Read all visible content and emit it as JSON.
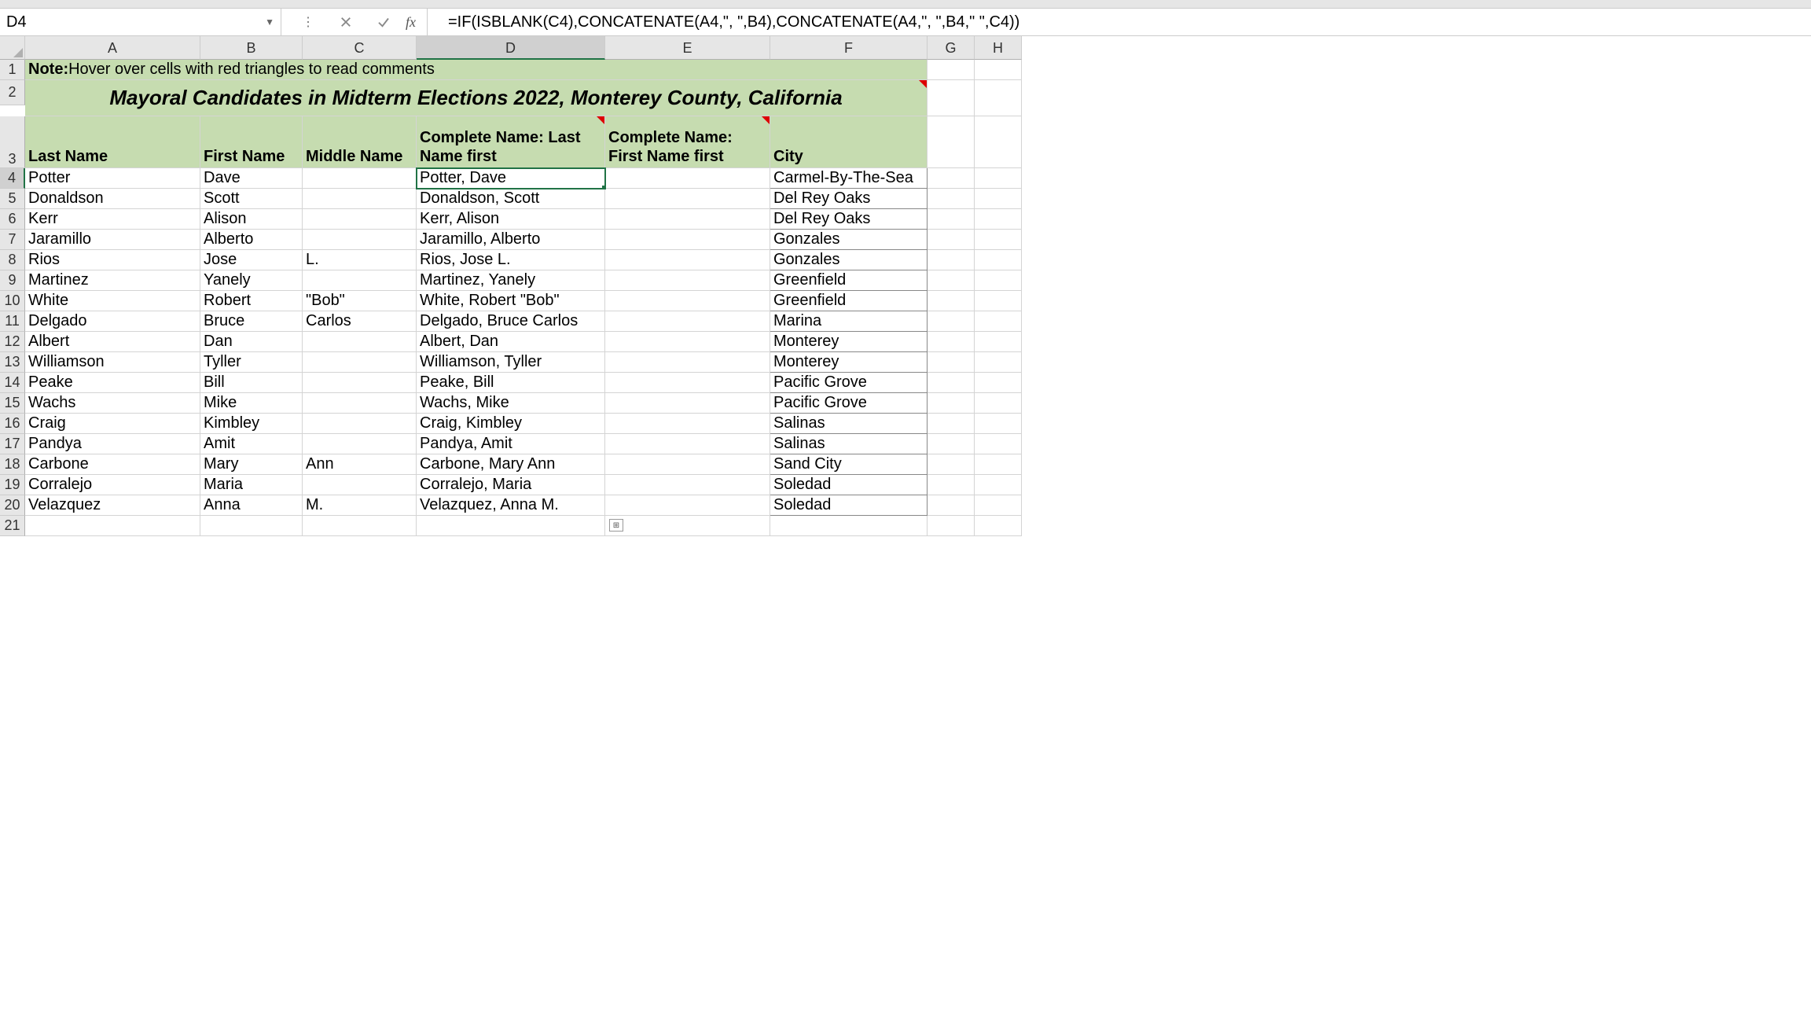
{
  "nameBox": "D4",
  "formula": "=IF(ISBLANK(C4),CONCATENATE(A4,\", \",B4),CONCATENATE(A4,\", \",B4,\" \",C4))",
  "fx": "fx",
  "columns": [
    "A",
    "B",
    "C",
    "D",
    "E",
    "F",
    "G",
    "H"
  ],
  "rowNumbers": [
    "1",
    "2",
    "3",
    "4",
    "5",
    "6",
    "7",
    "8",
    "9",
    "10",
    "11",
    "12",
    "13",
    "14",
    "15",
    "16",
    "17",
    "18",
    "19",
    "20",
    "21"
  ],
  "noteLabel": "Note:",
  "noteText": " Hover over cells with red triangles to read comments",
  "titleRow": "Mayoral Candidates in Midterm Elections 2022, Monterey County, California",
  "headers": {
    "A": "Last Name",
    "B": "First Name",
    "C": "Middle Name",
    "D": "Complete Name: Last Name first",
    "E": "Complete Name: First Name first",
    "F": "City"
  },
  "rows": [
    {
      "A": "Potter",
      "B": "Dave",
      "C": "",
      "D": "Potter, Dave",
      "E": "",
      "F": "Carmel-By-The-Sea"
    },
    {
      "A": "Donaldson",
      "B": "Scott",
      "C": "",
      "D": "Donaldson, Scott",
      "E": "",
      "F": "Del Rey Oaks"
    },
    {
      "A": "Kerr",
      "B": "Alison",
      "C": "",
      "D": "Kerr, Alison",
      "E": "",
      "F": "Del Rey Oaks"
    },
    {
      "A": "Jaramillo",
      "B": "Alberto",
      "C": "",
      "D": "Jaramillo, Alberto",
      "E": "",
      "F": "Gonzales"
    },
    {
      "A": "Rios",
      "B": "Jose",
      "C": "L.",
      "D": "Rios, Jose L.",
      "E": "",
      "F": "Gonzales"
    },
    {
      "A": "Martinez",
      "B": "Yanely",
      "C": "",
      "D": "Martinez, Yanely",
      "E": "",
      "F": "Greenfield"
    },
    {
      "A": "White",
      "B": "Robert",
      "C": "\"Bob\"",
      "D": "White, Robert \"Bob\"",
      "E": "",
      "F": "Greenfield"
    },
    {
      "A": "Delgado",
      "B": "Bruce",
      "C": "Carlos",
      "D": "Delgado, Bruce Carlos",
      "E": "",
      "F": "Marina"
    },
    {
      "A": "Albert",
      "B": "Dan",
      "C": "",
      "D": "Albert, Dan",
      "E": "",
      "F": "Monterey"
    },
    {
      "A": "Williamson",
      "B": "Tyller",
      "C": "",
      "D": "Williamson, Tyller",
      "E": "",
      "F": "Monterey"
    },
    {
      "A": "Peake",
      "B": "Bill",
      "C": "",
      "D": "Peake, Bill",
      "E": "",
      "F": "Pacific Grove"
    },
    {
      "A": "Wachs",
      "B": "Mike",
      "C": "",
      "D": "Wachs, Mike",
      "E": "",
      "F": "Pacific Grove"
    },
    {
      "A": "Craig",
      "B": "Kimbley",
      "C": "",
      "D": "Craig, Kimbley",
      "E": "",
      "F": "Salinas"
    },
    {
      "A": "Pandya",
      "B": "Amit",
      "C": "",
      "D": "Pandya, Amit",
      "E": "",
      "F": "Salinas"
    },
    {
      "A": "Carbone",
      "B": "Mary",
      "C": "Ann",
      "D": "Carbone, Mary Ann",
      "E": "",
      "F": "Sand City"
    },
    {
      "A": "Corralejo",
      "B": "Maria",
      "C": "",
      "D": "Corralejo, Maria",
      "E": "",
      "F": "Soledad"
    },
    {
      "A": "Velazquez",
      "B": "Anna",
      "C": "M.",
      "D": "Velazquez, Anna M.",
      "E": "",
      "F": "Soledad"
    }
  ],
  "selectedColumn": "D",
  "selectedRow": 4
}
